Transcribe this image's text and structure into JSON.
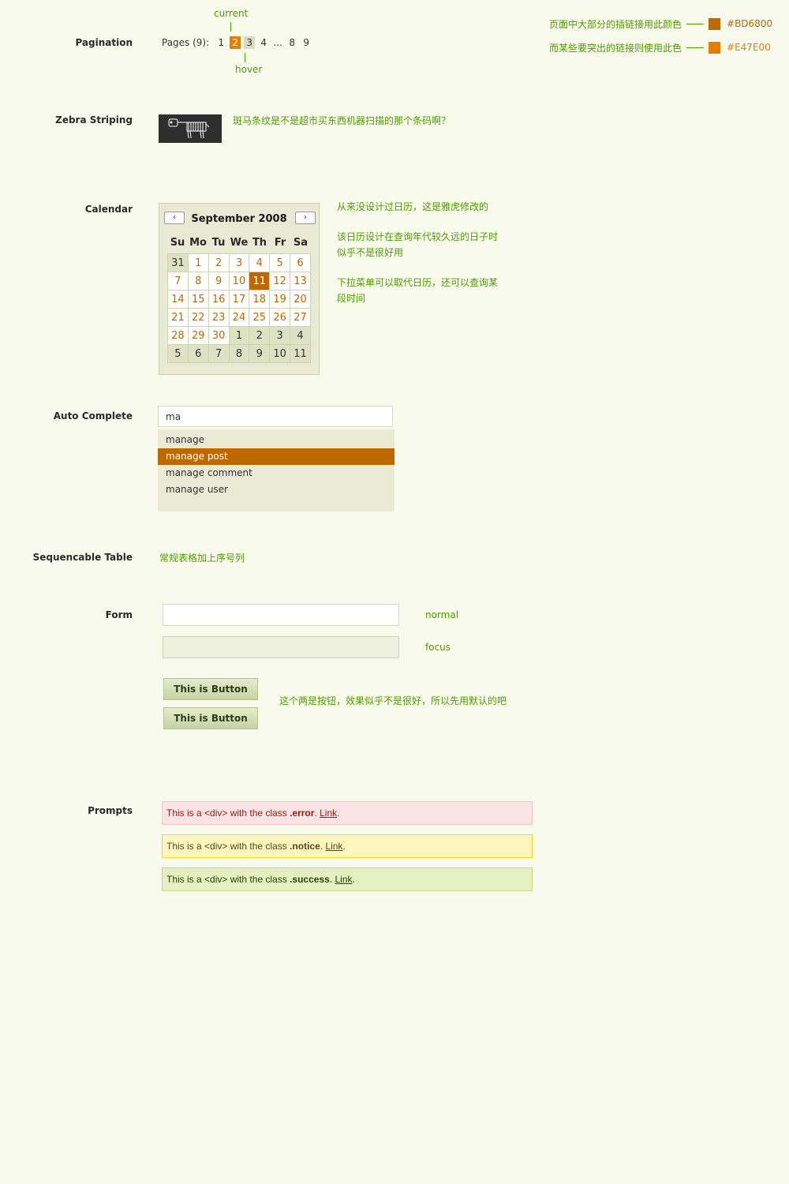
{
  "legend": {
    "main_link_note": "页面中大部分的插链接用此颜色",
    "main_link_hex": "#BD6800",
    "main_link_color": "#BD6800",
    "highlight_link_note": "而某些要突出的链接则使用此色",
    "highlight_link_hex": "#E47E00",
    "highlight_link_color": "#E47E00"
  },
  "pagination": {
    "section_label": "Pagination",
    "prefix": "Pages (9):",
    "pages": [
      "1",
      "2",
      "3",
      "4",
      "...",
      "8",
      "9"
    ],
    "current_note": "current",
    "hover_note": "hover"
  },
  "zebra": {
    "section_label": "Zebra Striping",
    "note": "斑马条纹是不是超市买东西机器扫描的那个条码啊？"
  },
  "calendar": {
    "section_label": "Calendar",
    "month_title": "September 2008",
    "weekdays": [
      "Su",
      "Mo",
      "Tu",
      "We",
      "Th",
      "Fr",
      "Sa"
    ],
    "weeks": [
      [
        "31",
        "1",
        "2",
        "3",
        "4",
        "5",
        "6"
      ],
      [
        "7",
        "8",
        "9",
        "10",
        "11",
        "12",
        "13"
      ],
      [
        "14",
        "15",
        "16",
        "17",
        "18",
        "19",
        "20"
      ],
      [
        "21",
        "22",
        "23",
        "24",
        "25",
        "26",
        "27"
      ],
      [
        "28",
        "29",
        "30",
        "1",
        "2",
        "3",
        "4"
      ],
      [
        "5",
        "6",
        "7",
        "8",
        "9",
        "10",
        "11"
      ]
    ],
    "selected_day": "11",
    "notes": [
      "从来没设计过日历，这是雅虎修改的",
      "该日历设计在查询年代较久远的日子时似乎不是很好用",
      "下拉菜单可以取代日历，还可以查询某段时间"
    ]
  },
  "autocomplete": {
    "section_label": "Auto Complete",
    "input_value": "ma",
    "suggestions": [
      "manage",
      "manage post",
      "manage comment",
      "manage user"
    ],
    "selected_suggestion": "manage post"
  },
  "sequencable": {
    "section_label": "Sequencable Table",
    "note": "常规表格加上序号列"
  },
  "form": {
    "section_label": "Form",
    "normal_note": "normal",
    "focus_note": "focus",
    "button_label_1": "This is Button",
    "button_label_2": "This is Button",
    "button_note": "这个两是按钮，效果似乎不是很好，所以先用默认的吧"
  },
  "prompts": {
    "section_label": "Prompts",
    "items": [
      {
        "prefix": "This is a <div> with the class ",
        "cls": ".error",
        "sep": ". ",
        "link": "Link",
        "end": "."
      },
      {
        "prefix": "This is a <div> with the class ",
        "cls": ".notice",
        "sep": ". ",
        "link": "Link",
        "end": "."
      },
      {
        "prefix": "This is a <div> with the class ",
        "cls": ".success",
        "sep": ". ",
        "link": "Link",
        "end": "."
      }
    ]
  }
}
